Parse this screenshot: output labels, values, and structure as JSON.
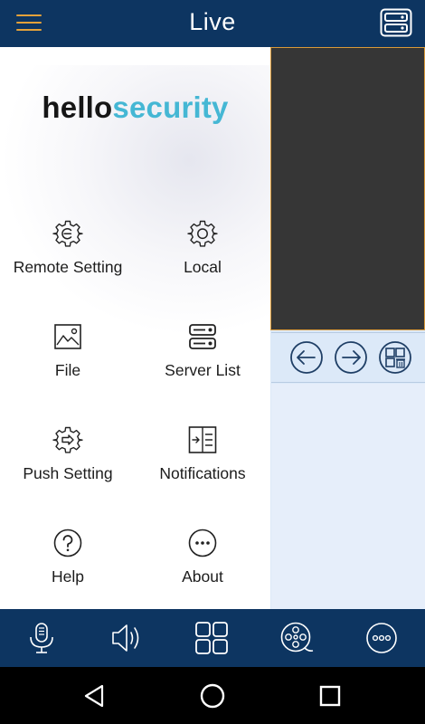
{
  "header": {
    "title": "Live"
  },
  "drawer": {
    "logo": {
      "part1": "hello",
      "part2": "security"
    },
    "items": [
      {
        "label": "Remote Setting",
        "icon": "remote-setting-icon"
      },
      {
        "label": "Local",
        "icon": "gear-icon"
      },
      {
        "label": "File",
        "icon": "image-icon"
      },
      {
        "label": "Server List",
        "icon": "server-list-icon"
      },
      {
        "label": "Push Setting",
        "icon": "push-setting-icon"
      },
      {
        "label": "Notifications",
        "icon": "notifications-icon"
      },
      {
        "label": "Help",
        "icon": "help-icon"
      },
      {
        "label": "About",
        "icon": "more-icon"
      }
    ]
  },
  "video_controls": [
    "previous-icon",
    "next-icon",
    "grid-delete-icon"
  ],
  "bottom_bar": [
    "microphone-icon",
    "speaker-icon",
    "grid-view-icon",
    "film-reel-icon",
    "more-icon"
  ],
  "system_nav": [
    "back-icon",
    "home-icon",
    "recents-icon"
  ],
  "colors": {
    "header": "#0d3561",
    "accent": "#e3a13a",
    "logo_accent": "#45b7d4",
    "panel": "#dce9f8"
  }
}
